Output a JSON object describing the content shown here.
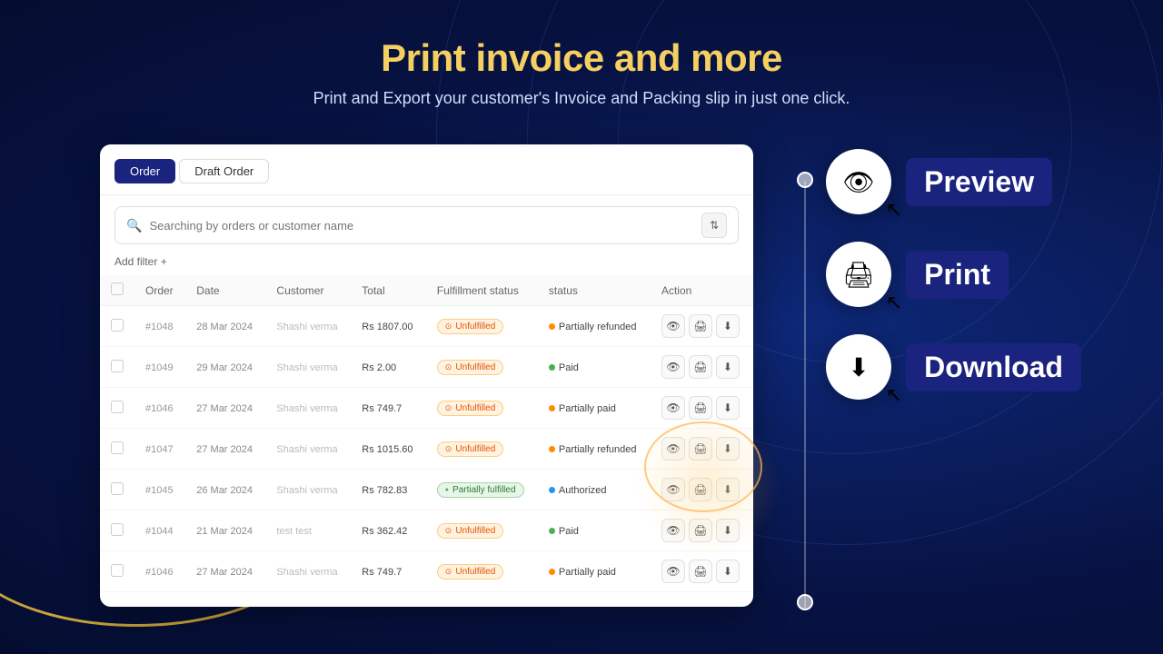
{
  "page": {
    "title": "Print invoice and more",
    "subtitle": "Print and Export your customer's Invoice  and Packing slip in just one click."
  },
  "tabs": [
    {
      "label": "Order",
      "active": true
    },
    {
      "label": "Draft Order",
      "active": false
    }
  ],
  "search": {
    "placeholder": "Searching by orders or customer name"
  },
  "add_filter": "Add filter +",
  "table": {
    "columns": [
      "",
      "Order",
      "Date",
      "Customer",
      "Total",
      "Fulfillment status",
      "status",
      "Action"
    ],
    "rows": [
      {
        "id": "#1048",
        "date": "28 Mar 2024",
        "customer": "Shashi verma",
        "total": "Rs 1807.00",
        "fulfillment": "Unfulfilled",
        "status": "Partially refunded",
        "fulfillment_type": "orange",
        "status_type": "partial-refund"
      },
      {
        "id": "#1049",
        "date": "29 Mar 2024",
        "customer": "Shashi verma",
        "total": "Rs 2.00",
        "fulfillment": "Unfulfilled",
        "status": "Paid",
        "fulfillment_type": "orange",
        "status_type": "paid"
      },
      {
        "id": "#1046",
        "date": "27 Mar 2024",
        "customer": "Shashi verma",
        "total": "Rs 749.7",
        "fulfillment": "Unfulfilled",
        "status": "Partially paid",
        "fulfillment_type": "orange",
        "status_type": "partial-paid"
      },
      {
        "id": "#1047",
        "date": "27 Mar 2024",
        "customer": "Shashi verma",
        "total": "Rs 1015.60",
        "fulfillment": "Unfulfilled",
        "status": "Partially refunded",
        "fulfillment_type": "orange",
        "status_type": "partial-refund"
      },
      {
        "id": "#1045",
        "date": "26 Mar 2024",
        "customer": "Shashi verma",
        "total": "Rs 782.83",
        "fulfillment": "Partially fulfilled",
        "status": "Authorized",
        "fulfillment_type": "partial",
        "status_type": "authorized"
      },
      {
        "id": "#1044",
        "date": "21 Mar 2024",
        "customer": "test test",
        "total": "Rs 362.42",
        "fulfillment": "Unfulfilled",
        "status": "Paid",
        "fulfillment_type": "orange",
        "status_type": "paid"
      },
      {
        "id": "#1046",
        "date": "27 Mar 2024",
        "customer": "Shashi verma",
        "total": "Rs 749.7",
        "fulfillment": "Unfulfilled",
        "status": "Partially paid",
        "fulfillment_type": "orange",
        "status_type": "partial-paid"
      }
    ]
  },
  "features": [
    {
      "name": "Preview",
      "icon": "👁",
      "cursor": "↖"
    },
    {
      "name": "Print",
      "icon": "🖨",
      "cursor": "↖"
    },
    {
      "name": "Download",
      "icon": "⬇",
      "cursor": "↖"
    }
  ],
  "action_header": "Action"
}
